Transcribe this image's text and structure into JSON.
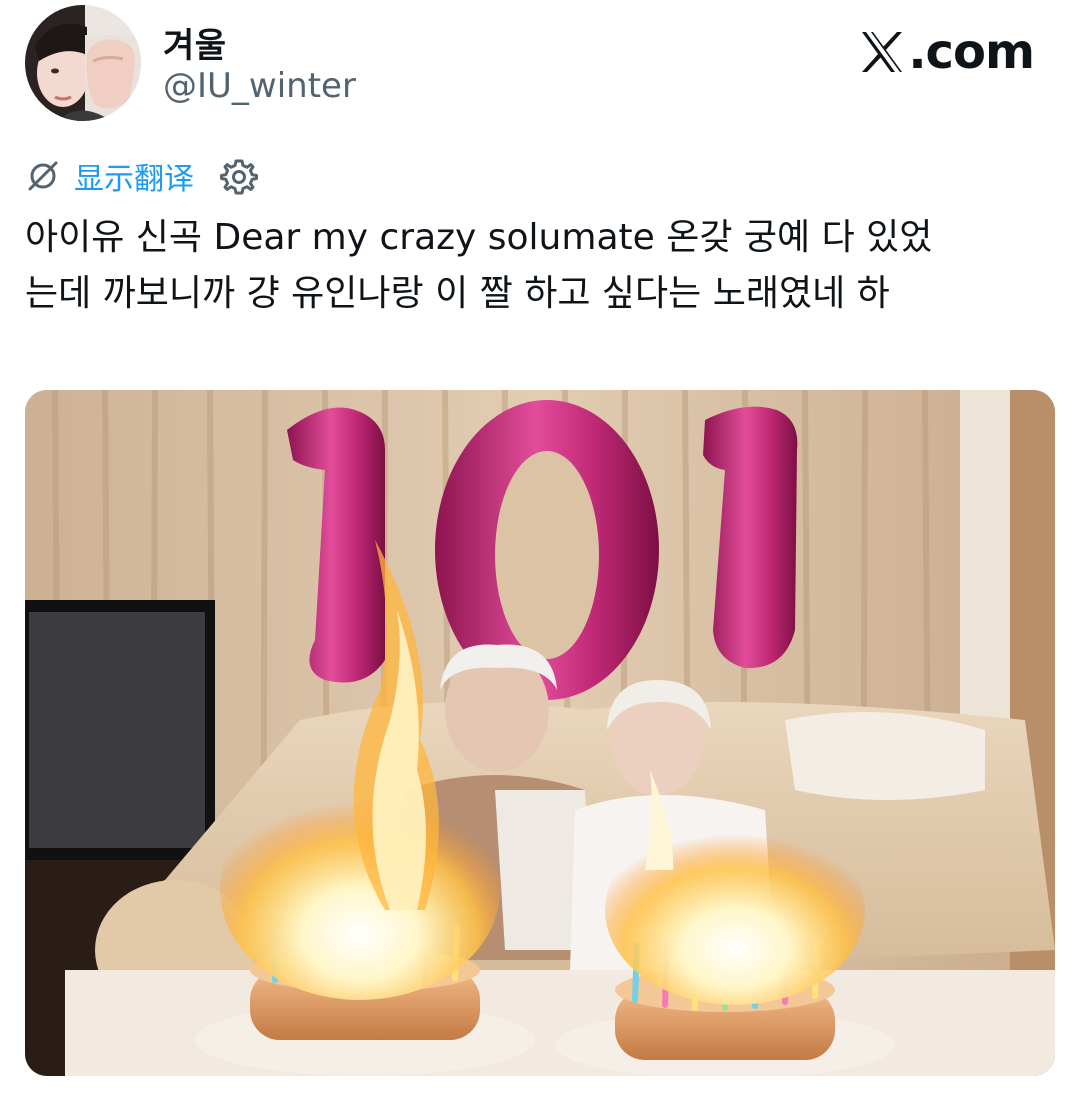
{
  "author": {
    "display_name": "겨울",
    "handle": "@IU_winter"
  },
  "brand": {
    "label": ".com",
    "icon": "x-logo-icon"
  },
  "translation": {
    "label": "显示翻译",
    "icon": "no-translate-icon",
    "settings_icon": "gear-icon"
  },
  "tweet": {
    "text": "아이유 신곡 Dear my crazy solumate 온갖 궁예 다 있었\n는데 까보니까 걍 유인나랑 이 짤 하고 싶다는 노래였네 하"
  },
  "photo": {
    "balloon_number": "101",
    "accent": "#d9307a"
  }
}
